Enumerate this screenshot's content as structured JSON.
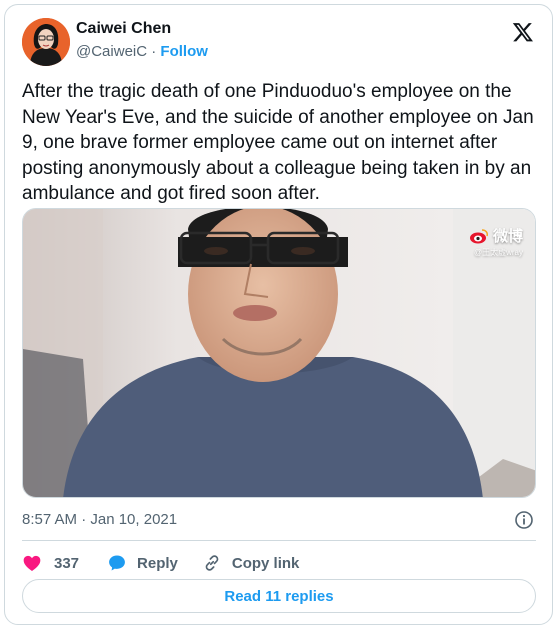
{
  "author": {
    "name": "Caiwei Chen",
    "handle": "@CaiweiC",
    "separator": "·",
    "follow_label": "Follow"
  },
  "tweet": {
    "text": "After the tragic death of one Pinduoduo's employee on the New Year's Eve, and the suicide of another employee on Jan 9, one brave former employee came out on internet after posting anonymously about a colleague being taken in by an ambulance and got fired soon after.",
    "timestamp": "8:57 AM · Jan 10, 2021"
  },
  "media": {
    "watermark": "微博",
    "watermark_sub": "@王太虚wray"
  },
  "actions": {
    "like_count": "337",
    "reply_label": "Reply",
    "copy_label": "Copy link"
  },
  "footer": {
    "read_replies_label": "Read 11 replies"
  },
  "colors": {
    "accent": "#1d9bf0",
    "like": "#f91880",
    "text_secondary": "#536471",
    "border": "#cfd9de"
  }
}
